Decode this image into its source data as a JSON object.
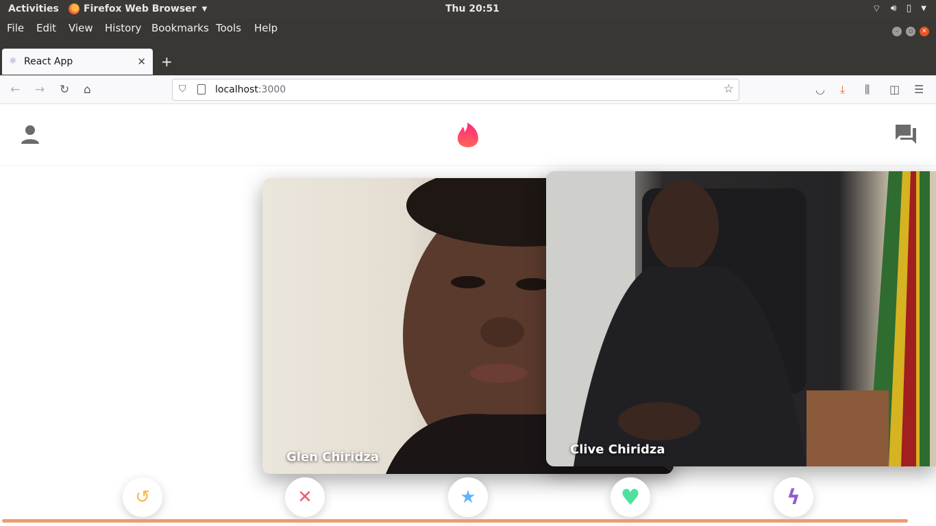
{
  "gnome": {
    "activities": "Activities",
    "app_name": "Firefox Web Browser",
    "clock": "Thu 20:51"
  },
  "menus": [
    "File",
    "Edit",
    "View",
    "History",
    "Bookmarks",
    "Tools",
    "Help"
  ],
  "tab": {
    "title": "React App"
  },
  "urlbar": {
    "host": "localhost",
    "port": ":3000"
  },
  "app": {
    "cards": [
      {
        "name": "Glen Chiridza"
      },
      {
        "name": "Clive Chiridza"
      }
    ],
    "buttons": [
      {
        "icon": "undo-icon",
        "glyph": "↺",
        "color": "#f5b748"
      },
      {
        "icon": "close-icon",
        "glyph": "✕",
        "color": "#ec5e6f"
      },
      {
        "icon": "star-icon",
        "glyph": "★",
        "color": "#62b4f9"
      },
      {
        "icon": "heart-icon",
        "glyph": "♥",
        "color": "#4fe0a0"
      },
      {
        "icon": "bolt-icon",
        "glyph": "ϟ",
        "color": "#915dd1"
      }
    ],
    "accent": "#fd267d"
  }
}
